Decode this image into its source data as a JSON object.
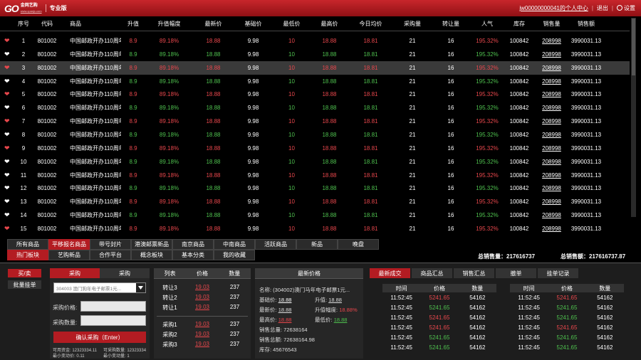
{
  "header": {
    "logo_text": "金网艺购",
    "logo_url": "www.cpanjx.com",
    "edition": "专业版",
    "user_center": "jw00000000041的个人中心",
    "logout": "退出",
    "settings": "设置"
  },
  "table": {
    "columns": [
      "序号",
      "代码",
      "商品",
      "升值",
      "升值幅度",
      "最新价",
      "基础价",
      "最低价",
      "最高价",
      "今日均价",
      "采购量",
      "转让量",
      "人气",
      "库存",
      "销售量",
      "销售额"
    ],
    "rows": [
      {
        "no": "1",
        "code": "801002",
        "name": "中国邮政开办110周年...",
        "rise": "8.9",
        "pct": "89.18%",
        "latest": "18.88",
        "base": "9.98",
        "low": "10",
        "high": "18.88",
        "avg": "18.81",
        "buy": "21",
        "transfer": "16",
        "pop": "195.32%",
        "stock": "100842",
        "sold": "208998",
        "amount": "3990031.13",
        "heart": "red",
        "color": "red"
      },
      {
        "no": "2",
        "code": "801002",
        "name": "中国邮政开办110周年...",
        "rise": "8.9",
        "pct": "89.18%",
        "latest": "18.88",
        "base": "9.98",
        "low": "10",
        "high": "18.88",
        "avg": "18.81",
        "buy": "21",
        "transfer": "16",
        "pop": "195.32%",
        "stock": "100842",
        "sold": "208998",
        "amount": "3990031.13",
        "heart": "white",
        "color": "green"
      },
      {
        "no": "3",
        "code": "801002",
        "name": "中国邮政开办110周年...",
        "rise": "8.9",
        "pct": "89.18%",
        "latest": "18.88",
        "base": "9.98",
        "low": "10",
        "high": "18.88",
        "avg": "18.81",
        "buy": "21",
        "transfer": "16",
        "pop": "195.32%",
        "stock": "100842",
        "sold": "208998",
        "amount": "3990031.13",
        "heart": "red",
        "color": "red"
      },
      {
        "no": "4",
        "code": "801002",
        "name": "中国邮政开办110周年...",
        "rise": "8.9",
        "pct": "89.18%",
        "latest": "18.88",
        "base": "9.98",
        "low": "10",
        "high": "18.88",
        "avg": "18.81",
        "buy": "21",
        "transfer": "16",
        "pop": "195.32%",
        "stock": "100842",
        "sold": "208998",
        "amount": "3990031.13",
        "heart": "white",
        "color": "green"
      },
      {
        "no": "5",
        "code": "801002",
        "name": "中国邮政开办110周年...",
        "rise": "8.9",
        "pct": "89.18%",
        "latest": "18.88",
        "base": "9.98",
        "low": "10",
        "high": "18.88",
        "avg": "18.81",
        "buy": "21",
        "transfer": "16",
        "pop": "195.32%",
        "stock": "100842",
        "sold": "208998",
        "amount": "3990031.13",
        "heart": "red",
        "color": "red"
      },
      {
        "no": "6",
        "code": "801002",
        "name": "中国邮政开办110周年...",
        "rise": "8.9",
        "pct": "89.18%",
        "latest": "18.88",
        "base": "9.98",
        "low": "10",
        "high": "18.88",
        "avg": "18.81",
        "buy": "21",
        "transfer": "16",
        "pop": "195.32%",
        "stock": "100842",
        "sold": "208998",
        "amount": "3990031.13",
        "heart": "white",
        "color": "green"
      },
      {
        "no": "7",
        "code": "801002",
        "name": "中国邮政开办110周年...",
        "rise": "8.9",
        "pct": "89.18%",
        "latest": "18.88",
        "base": "9.98",
        "low": "10",
        "high": "18.88",
        "avg": "18.81",
        "buy": "21",
        "transfer": "16",
        "pop": "195.32%",
        "stock": "100842",
        "sold": "208998",
        "amount": "3990031.13",
        "heart": "red",
        "color": "red"
      },
      {
        "no": "8",
        "code": "801002",
        "name": "中国邮政开办110周年...",
        "rise": "8.9",
        "pct": "89.18%",
        "latest": "18.88",
        "base": "9.98",
        "low": "10",
        "high": "18.88",
        "avg": "18.81",
        "buy": "21",
        "transfer": "16",
        "pop": "195.32%",
        "stock": "100842",
        "sold": "208998",
        "amount": "3990031.13",
        "heart": "white",
        "color": "green"
      },
      {
        "no": "9",
        "code": "801002",
        "name": "中国邮政开办110周年...",
        "rise": "8.9",
        "pct": "89.18%",
        "latest": "18.88",
        "base": "9.98",
        "low": "10",
        "high": "18.88",
        "avg": "18.81",
        "buy": "21",
        "transfer": "16",
        "pop": "195.32%",
        "stock": "100842",
        "sold": "208998",
        "amount": "3990031.13",
        "heart": "red",
        "color": "red"
      },
      {
        "no": "10",
        "code": "801002",
        "name": "中国邮政开办110周年...",
        "rise": "8.9",
        "pct": "89.18%",
        "latest": "18.88",
        "base": "9.98",
        "low": "10",
        "high": "18.88",
        "avg": "18.81",
        "buy": "21",
        "transfer": "16",
        "pop": "195.32%",
        "stock": "100842",
        "sold": "208998",
        "amount": "3990031.13",
        "heart": "white",
        "color": "green"
      },
      {
        "no": "11",
        "code": "801002",
        "name": "中国邮政开办110周年...",
        "rise": "8.9",
        "pct": "89.18%",
        "latest": "18.88",
        "base": "9.98",
        "low": "10",
        "high": "18.88",
        "avg": "18.81",
        "buy": "21",
        "transfer": "16",
        "pop": "195.32%",
        "stock": "100842",
        "sold": "208998",
        "amount": "3990031.13",
        "heart": "white",
        "color": "red"
      },
      {
        "no": "12",
        "code": "801002",
        "name": "中国邮政开办110周年...",
        "rise": "8.9",
        "pct": "89.18%",
        "latest": "18.88",
        "base": "9.98",
        "low": "10",
        "high": "18.88",
        "avg": "18.81",
        "buy": "21",
        "transfer": "16",
        "pop": "195.32%",
        "stock": "100842",
        "sold": "208998",
        "amount": "3990031.13",
        "heart": "white",
        "color": "green"
      },
      {
        "no": "13",
        "code": "801002",
        "name": "中国邮政开办110周年...",
        "rise": "8.9",
        "pct": "89.18%",
        "latest": "18.88",
        "base": "9.98",
        "low": "10",
        "high": "18.88",
        "avg": "18.81",
        "buy": "21",
        "transfer": "16",
        "pop": "195.32%",
        "stock": "100842",
        "sold": "208998",
        "amount": "3990031.13",
        "heart": "white",
        "color": "red"
      },
      {
        "no": "14",
        "code": "801002",
        "name": "中国邮政开办110周年...",
        "rise": "8.9",
        "pct": "89.18%",
        "latest": "18.88",
        "base": "9.98",
        "low": "10",
        "high": "18.88",
        "avg": "18.81",
        "buy": "21",
        "transfer": "16",
        "pop": "195.32%",
        "stock": "100842",
        "sold": "208998",
        "amount": "3990031.13",
        "heart": "white",
        "color": "green"
      },
      {
        "no": "15",
        "code": "801002",
        "name": "中国邮政开办110周年...",
        "rise": "8.9",
        "pct": "89.18%",
        "latest": "18.88",
        "base": "9.98",
        "low": "10",
        "high": "18.88",
        "avg": "18.81",
        "buy": "21",
        "transfer": "16",
        "pop": "195.32%",
        "stock": "100842",
        "sold": "208998",
        "amount": "3990031.13",
        "heart": "red",
        "color": "red"
      }
    ]
  },
  "tabs": [
    "所有商品",
    "平移报名商品",
    "带号封片",
    "港澳邮票新品",
    "南京商品",
    "中南商品",
    "活跃商品",
    "新品",
    "晚盘",
    "热门板块",
    "艺购新品",
    "合作平台",
    "概念板块",
    "基本分类",
    "我的收藏"
  ],
  "totals": {
    "sales_volume_label": "总销售量",
    "sales_volume": "217616737",
    "sales_amount_label": "总销售额",
    "sales_amount": "217616737.87"
  },
  "trade": {
    "buy_sell": "买/卖",
    "batch": "批量挂单",
    "tab_buy": "采购",
    "tab_buy2": "采购",
    "select_value": "304003 澳门狗年电子邮票1元...",
    "price_label": "采购价格:",
    "qty_label": "采购数量:",
    "confirm": "确认采购（Enter）",
    "avail_funds": "可用资金: 12323334.11",
    "avail_qty": "可采购数量: 12323334",
    "min_change": "最小变动价: 0.11",
    "min_change_qty": "最小变动量: 1"
  },
  "orderbook": {
    "headers": [
      "列表",
      "价格",
      "数量"
    ],
    "sells": [
      {
        "label": "转让3",
        "price": "19.03",
        "qty": "237"
      },
      {
        "label": "转让2",
        "price": "19.03",
        "qty": "237"
      },
      {
        "label": "转让1",
        "price": "19.03",
        "qty": "237"
      }
    ],
    "buys": [
      {
        "label": "采购1",
        "price": "19.03",
        "qty": "237"
      },
      {
        "label": "采购2",
        "price": "19.03",
        "qty": "237"
      },
      {
        "label": "采购3",
        "price": "19.03",
        "qty": "237"
      }
    ]
  },
  "latest": {
    "title": "最新价格",
    "name": "名称: (304002)澳门马年电子邮票1元...",
    "base_label": "基础价:",
    "base": "18.88",
    "rise_label": "升值:",
    "rise": "18.88",
    "latest_label": "最新价:",
    "latest": "18.88",
    "rise_pct_label": "升值幅度:",
    "rise_pct": "18.88%",
    "high_label": "最高价:",
    "high": "18.88",
    "low_label": "最低价:",
    "low": "18.88",
    "total_qty": "销售总量: 72638164",
    "total_amount": "销售总额: 72638164.98",
    "stock": "库存: 45676543"
  },
  "deals": {
    "tabs": [
      "最新成交",
      "商品汇总",
      "销售汇总",
      "撤单",
      "挂单记录"
    ],
    "headers": [
      "时间",
      "价格",
      "数量"
    ],
    "left": [
      {
        "t": "11:52:45",
        "p": "5241.65",
        "q": "54162",
        "c": "red"
      },
      {
        "t": "11:52:45",
        "p": "5241.65",
        "q": "54162",
        "c": "green"
      },
      {
        "t": "11:52:45",
        "p": "5241.65",
        "q": "54162",
        "c": "red"
      },
      {
        "t": "11:52:45",
        "p": "5241.65",
        "q": "54162",
        "c": "red"
      },
      {
        "t": "11:52:45",
        "p": "5241.65",
        "q": "54162",
        "c": "green"
      },
      {
        "t": "11:52:45",
        "p": "5241.65",
        "q": "54162",
        "c": "green"
      }
    ],
    "right": [
      {
        "t": "11:52:45",
        "p": "5241.65",
        "q": "54162",
        "c": "red"
      },
      {
        "t": "11:52:45",
        "p": "5241.65",
        "q": "54162",
        "c": "green"
      },
      {
        "t": "11:52:45",
        "p": "5241.65",
        "q": "54162",
        "c": "green"
      },
      {
        "t": "11:52:45",
        "p": "5241.65",
        "q": "54162",
        "c": "red"
      },
      {
        "t": "11:52:45",
        "p": "5241.65",
        "q": "54162",
        "c": "green"
      },
      {
        "t": "11:52:45",
        "p": "5241.65",
        "q": "54162",
        "c": "green"
      }
    ]
  },
  "colors": {
    "brand": "#b31c22",
    "up": "#e8474c",
    "down": "#4ec04e"
  }
}
